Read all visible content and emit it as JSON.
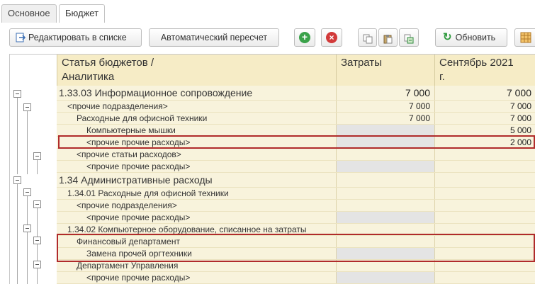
{
  "tabs": [
    {
      "label": "Основное"
    },
    {
      "label": "Бюджет"
    }
  ],
  "toolbar": {
    "edit_label": "Редактировать в списке",
    "recalc_label": "Автоматический пересчет",
    "refresh_label": "Обновить",
    "colors": {
      "add": "#3aa24a",
      "delete": "#d23a3a",
      "refresh": "#2f9a3e"
    }
  },
  "table": {
    "headers": {
      "article_line1": "Статья бюджетов /",
      "article_line2": "Аналитика",
      "costs": "Затраты",
      "month_line1": "Сентябрь 2021",
      "month_line2": "г."
    },
    "rows": [
      {
        "name": "1.33.03 Информационное сопровождение",
        "costs": "7 000",
        "month": "7 000"
      },
      {
        "name": "<прочие подразделения>",
        "costs": "7 000",
        "month": "7 000"
      },
      {
        "name": "Расходные для офисной техники",
        "costs": "7 000",
        "month": "7 000"
      },
      {
        "name": "Компьютерные мышки",
        "costs": "",
        "month": "5 000"
      },
      {
        "name": "<прочие прочие расходы>",
        "costs": "",
        "month": "2 000"
      },
      {
        "name": "<прочие статьи расходов>",
        "costs": "",
        "month": ""
      },
      {
        "name": "<прочие прочие расходы>",
        "costs": "",
        "month": ""
      },
      {
        "name": "1.34 Административные расходы",
        "costs": "",
        "month": ""
      },
      {
        "name": "1.34.01 Расходные для офисной техники",
        "costs": "",
        "month": ""
      },
      {
        "name": "<прочие подразделения>",
        "costs": "",
        "month": ""
      },
      {
        "name": "<прочие прочие расходы>",
        "costs": "",
        "month": ""
      },
      {
        "name": "1.34.02 Компьютерное оборудование, списанное на затраты",
        "costs": "",
        "month": ""
      },
      {
        "name": "Финансовый департамент",
        "costs": "",
        "month": ""
      },
      {
        "name": "Замена прочей оргтехники",
        "costs": "",
        "month": ""
      },
      {
        "name": "Департамент Управления",
        "costs": "",
        "month": ""
      },
      {
        "name": "<прочие прочие расходы>",
        "costs": "",
        "month": ""
      }
    ]
  }
}
